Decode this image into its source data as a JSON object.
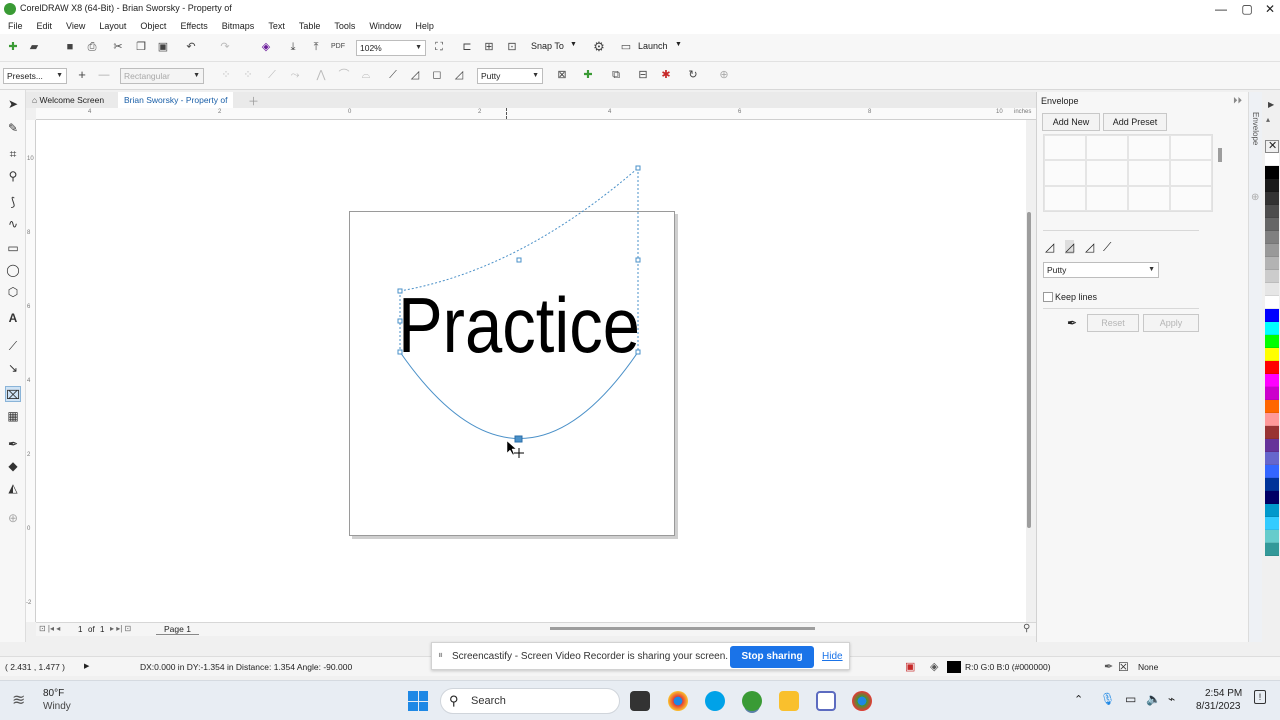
{
  "window": {
    "title": "CorelDRAW X8 (64-Bit) - Brian Sworsky - Property of",
    "minimize": "—",
    "maximize": "▢",
    "close": "✕"
  },
  "menu": [
    "File",
    "Edit",
    "View",
    "Layout",
    "Object",
    "Effects",
    "Bitmaps",
    "Text",
    "Table",
    "Tools",
    "Window",
    "Help"
  ],
  "toolbar": {
    "zoom": "102%",
    "snap_to": "Snap To",
    "launch": "Launch"
  },
  "property_bar": {
    "presets": "Presets...",
    "mode": "Rectangular",
    "mapping_mode": "Putty"
  },
  "doc_tabs": {
    "welcome": "Welcome Screen",
    "document": "Brian Sworsky - Property of"
  },
  "ruler": {
    "unit": "inches",
    "h_ticks": [
      "4",
      "2",
      "0",
      "2",
      "4",
      "6",
      "8",
      "10"
    ],
    "v_ticks": [
      "10",
      "8",
      "6",
      "4",
      "2",
      "0",
      "-2"
    ]
  },
  "canvas": {
    "text": "Practice"
  },
  "page_nav": {
    "current": "1",
    "of": "of",
    "total": "1",
    "page_tab": "Page 1"
  },
  "status": {
    "coords": "( 2.431 , 1.477 )",
    "info": "DX:0.000 in DY:-1.354 in Distance: 1.354 Angle: -90.000",
    "fill_color": "R:0 G:0 B:0 (#000000)",
    "outline": "None"
  },
  "docker": {
    "title": "Envelope",
    "tab_label": "Envelope",
    "add_new": "Add New",
    "add_preset": "Add Preset",
    "mapping_mode": "Putty",
    "keep_lines": "Keep lines",
    "reset": "Reset",
    "apply": "Apply"
  },
  "palette": [
    "#ffffff",
    "#000000",
    "#1a1a1a",
    "#333333",
    "#4d4d4d",
    "#666666",
    "#808080",
    "#999999",
    "#b3b3b3",
    "#cccccc",
    "#e6e6e6",
    "#ffffff",
    "#0000ff",
    "#00ffff",
    "#00ff00",
    "#ffff00",
    "#ff0000",
    "#ff00ff",
    "#cc00cc",
    "#ff6600",
    "#ff9999",
    "#993333",
    "#663399",
    "#6666cc",
    "#3366ff",
    "#003399",
    "#000066",
    "#0099cc",
    "#33ccff",
    "#66cccc",
    "#339999"
  ],
  "share_bar": {
    "message": "Screencastify - Screen Video Recorder is sharing your screen.",
    "stop": "Stop sharing",
    "hide": "Hide"
  },
  "taskbar": {
    "temp": "80°F",
    "weather": "Windy",
    "search": "Search",
    "time": "2:54 PM",
    "date": "8/31/2023"
  }
}
